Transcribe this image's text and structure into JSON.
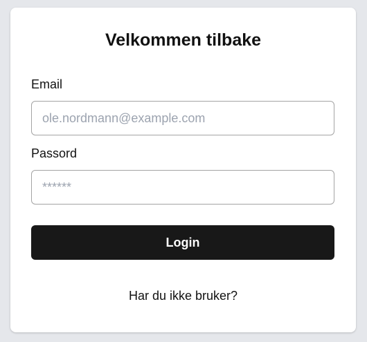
{
  "login_form": {
    "title": "Velkommen tilbake",
    "email_label": "Email",
    "email_placeholder": "ole.nordmann@example.com",
    "email_value": "",
    "password_label": "Passord",
    "password_placeholder": "******",
    "password_value": "",
    "login_label": "Login",
    "signup_link": "Har du ikke bruker?"
  },
  "colors": {
    "background": "#e5e7eb",
    "card": "#ffffff",
    "button": "#181818",
    "button_text": "#ffffff",
    "placeholder": "#9ca3af",
    "input_border": "#a3a3a3"
  }
}
